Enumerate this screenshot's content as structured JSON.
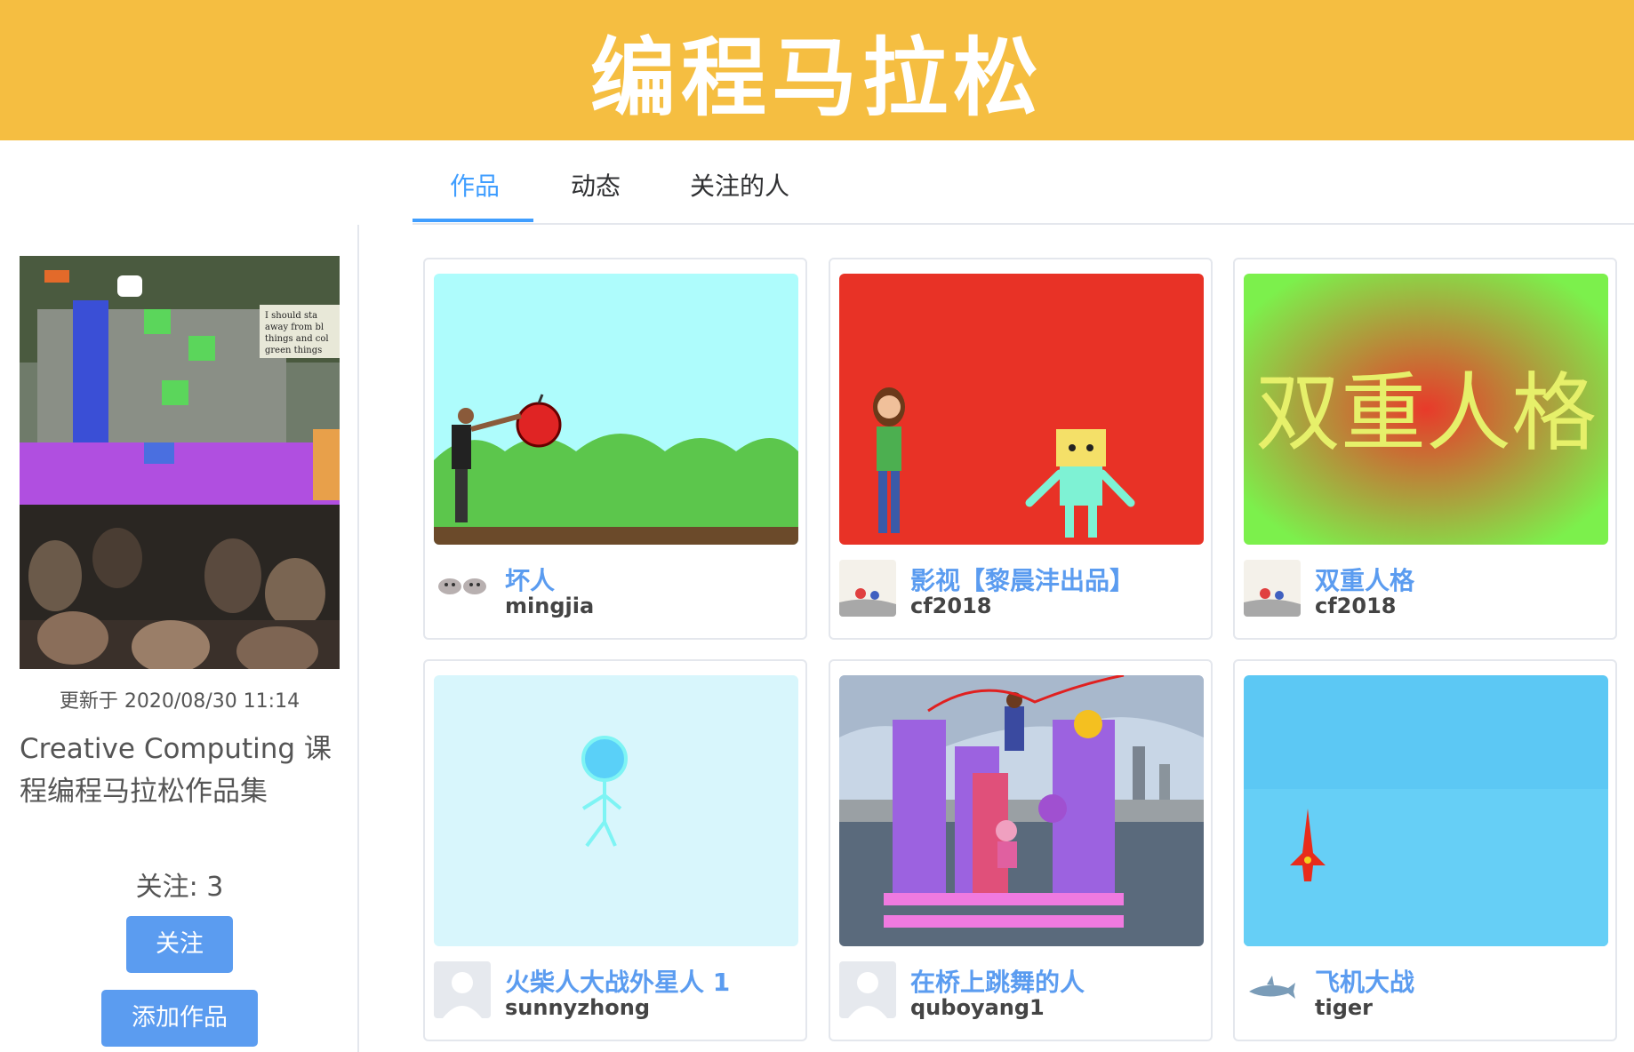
{
  "banner": {
    "title": "编程马拉松"
  },
  "tabs": [
    {
      "label": "作品",
      "active": true
    },
    {
      "label": "动态",
      "active": false
    },
    {
      "label": "关注的人",
      "active": false
    }
  ],
  "studio": {
    "updated": "更新于 2020/08/30 11:14",
    "title": "Creative Computing 课程编程马拉松作品集",
    "followers": "关注: 3",
    "follow_label": "关注",
    "add_label": "添加作品",
    "cover_text": "I should stay away from bl things and colo green things"
  },
  "projects": [
    {
      "title": "坏人",
      "author": "mingjia",
      "thumb": "apple"
    },
    {
      "title": "影视【黎晨沣出品】",
      "author": "cf2018",
      "thumb": "robot"
    },
    {
      "title": "双重人格",
      "author": "cf2018",
      "thumb": "text",
      "thumb_text": "双重人格"
    },
    {
      "title": "火柴人大战外星人 1",
      "author": "sunnyzhong",
      "thumb": "stickman"
    },
    {
      "title": "在桥上跳舞的人",
      "author": "quboyang1",
      "thumb": "bridge"
    },
    {
      "title": "飞机大战",
      "author": "tiger",
      "thumb": "plane"
    }
  ],
  "colors": {
    "banner": "#f5be41",
    "accent": "#409eff",
    "button": "#5b9cf0",
    "link": "#5b9cf0"
  }
}
